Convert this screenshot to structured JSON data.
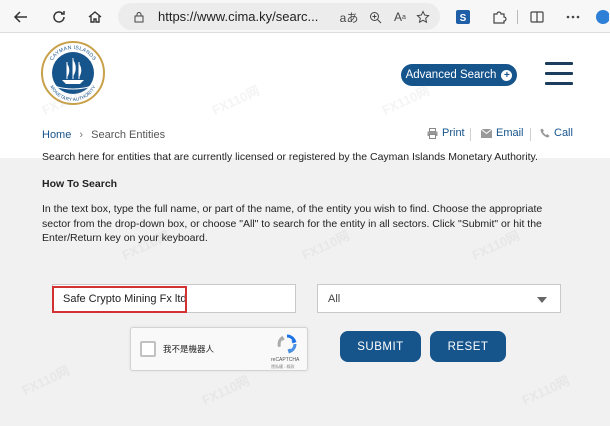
{
  "browser": {
    "url": "https://www.cima.ky/searc...",
    "icons": [
      "back-arrow-icon",
      "refresh-icon",
      "home-icon",
      "lock-icon",
      "read-aloud-icon",
      "zoom-icon",
      "text-size-icon",
      "favorite-star-icon",
      "extension-icon",
      "puzzle-icon",
      "split-screen-icon",
      "more-icon"
    ]
  },
  "logo": {
    "top_text": "CAYMAN ISLANDS",
    "bottom_text": "MONETARY AUTHORITY"
  },
  "header": {
    "advanced_search_label": "Advanced Search",
    "menu_icon": "hamburger-icon"
  },
  "breadcrumb": {
    "home": "Home",
    "current": "Search Entities"
  },
  "actions": {
    "print": "Print",
    "email": "Email",
    "call": "Call"
  },
  "content": {
    "intro": "Search here for entities that are currently licensed or registered by the Cayman Islands Monetary Authority.",
    "how_to_title": "How To Search",
    "instructions": "In the text box, type the full name, or part of the name, of the entity you wish to find. Choose the appropriate sector from the drop-down box, or choose \"All\" to search for the entity in all sectors. Click \"Submit\" or hit the Enter/Return key on your keyboard."
  },
  "search": {
    "value": "Safe Crypto Mining Fx ltd",
    "sector_selected": "All"
  },
  "captcha": {
    "label": "我不是機器人",
    "brand": "reCAPTCHA",
    "terms": "隱私權 - 條款"
  },
  "buttons": {
    "submit": "SUBMIT",
    "reset": "RESET"
  },
  "watermark": "FX110网",
  "colors": {
    "brand_blue": "#16548c",
    "highlight_red": "#d33232"
  }
}
